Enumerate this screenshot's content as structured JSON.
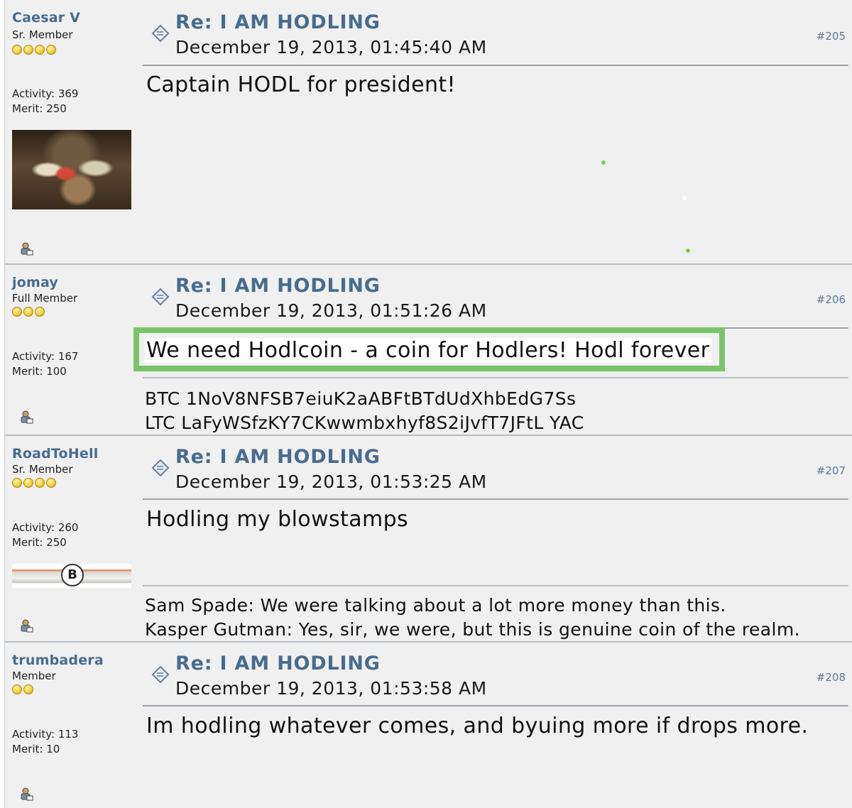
{
  "posts": [
    {
      "username": "Caesar V",
      "rank": "Sr. Member",
      "stars": 4,
      "activity": "Activity: 369",
      "merit": "Merit: 250",
      "subject": "Re: I AM HODLING",
      "date": "December 19, 2013, 01:45:40 AM",
      "number": "#205",
      "message": "Captain HODL for president!"
    },
    {
      "username": "jomay",
      "rank": "Full Member",
      "stars": 3,
      "activity": "Activity: 167",
      "merit": "Merit: 100",
      "subject": "Re: I AM HODLING",
      "date": "December 19, 2013, 01:51:26 AM",
      "number": "#206",
      "message": "We need Hodlcoin - a coin for Hodlers! Hodl forever",
      "signature": [
        "BTC 1NoV8NFSB7eiuK2aABFtBTdUdXhbEdG7Ss",
        "LTC LaFyWSfzKY7CKwwmbxhyf8S2iJvfT7JFtL YAC"
      ]
    },
    {
      "username": "RoadToHell",
      "rank": "Sr. Member",
      "stars": 4,
      "activity": "Activity: 260",
      "merit": "Merit: 250",
      "subject": "Re: I AM HODLING",
      "date": "December 19, 2013, 01:53:25 AM",
      "number": "#207",
      "message": "Hodling my blowstamps",
      "avatar_banner_glyph": "B",
      "signature": [
        "Sam Spade: We were talking about a lot more money than this.",
        "Kasper Gutman: Yes, sir, we were, but this is genuine coin of the realm."
      ]
    },
    {
      "username": "trumbadera",
      "rank": "Member",
      "stars": 2,
      "activity": "Activity: 113",
      "merit": "Merit: 10",
      "subject": "Re: I AM HODLING",
      "date": "December 19, 2013, 01:53:58 AM",
      "number": "#208",
      "message": "Im hodling whatever comes, and byuing more if drops more."
    }
  ],
  "colors": {
    "link": "#476c8e",
    "post_bg": "#f0f0f0",
    "highlight": "#7bc36b"
  },
  "icons": [
    "message-icon",
    "profile-icon",
    "star-icon"
  ]
}
